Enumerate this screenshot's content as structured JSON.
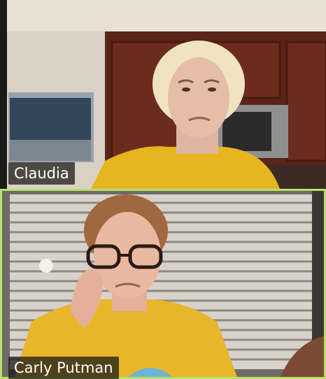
{
  "participants": [
    {
      "name": "Claudia",
      "active_speaker": false
    },
    {
      "name": "Carly Putman",
      "active_speaker": true
    }
  ],
  "colors": {
    "active_speaker_border": "#b9e06a",
    "name_tag_background": "#141414",
    "name_tag_text": "#ffffff"
  }
}
